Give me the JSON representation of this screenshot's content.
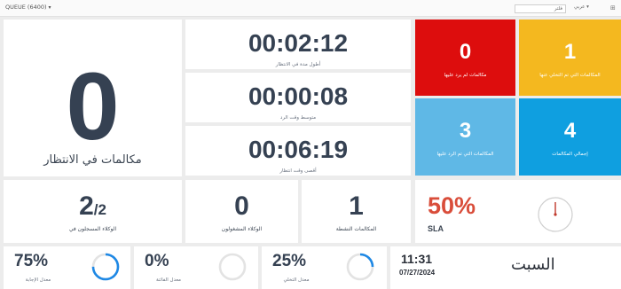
{
  "topbar": {
    "queue_label": "QUEUE (6400)",
    "search_placeholder": "فلتر",
    "language": "عربي",
    "grid_icon": "grid-icon",
    "chevron_icon": "chevron-down-icon"
  },
  "waiting": {
    "value": "0",
    "label": "مكالمات في الانتظار"
  },
  "timers": [
    {
      "value": "00:02:12",
      "label": "أطول مدة في الانتظار"
    },
    {
      "value": "00:00:08",
      "label": "متوسط وقت الرد"
    },
    {
      "value": "00:06:19",
      "label": "أقصى وقت انتظار"
    }
  ],
  "tiles": [
    {
      "value": "0",
      "label": "مكالمات لم يرد عليها",
      "color": "#dd0d0d"
    },
    {
      "value": "1",
      "label": "المكالمات التي تم التخلي عنها",
      "color": "#f4b81f"
    },
    {
      "value": "3",
      "label": "المكالمات التي تم الرد عليها",
      "color": "#5fb8e6"
    },
    {
      "value": "4",
      "label": "إجمالي المكالمات",
      "color": "#0f9fe0"
    }
  ],
  "agents": {
    "logged_in": {
      "value": "2",
      "of": "/2",
      "label": "الوكلاء المسجلون في"
    },
    "busy": {
      "value": "0",
      "label": "الوكلاء المشغولون"
    },
    "active_calls": {
      "value": "1",
      "label": "المكالمات النشطة"
    }
  },
  "sla": {
    "value": "50%",
    "label": "SLA",
    "level": 0.5
  },
  "rates": [
    {
      "value": "75%",
      "label": "معدل الإجابة",
      "level": 0.75
    },
    {
      "value": "0%",
      "label": "معدل الفائتة",
      "level": 0.0
    },
    {
      "value": "25%",
      "label": "معدل التخلي",
      "level": 0.25
    }
  ],
  "clock": {
    "time": "11:31",
    "date": "07/27/2024",
    "day": "السبت"
  },
  "colors": {
    "ring": "#1e88e5",
    "ring_track": "#e3e3e3",
    "sla_value": "#d94d3a",
    "text": "#354152"
  }
}
